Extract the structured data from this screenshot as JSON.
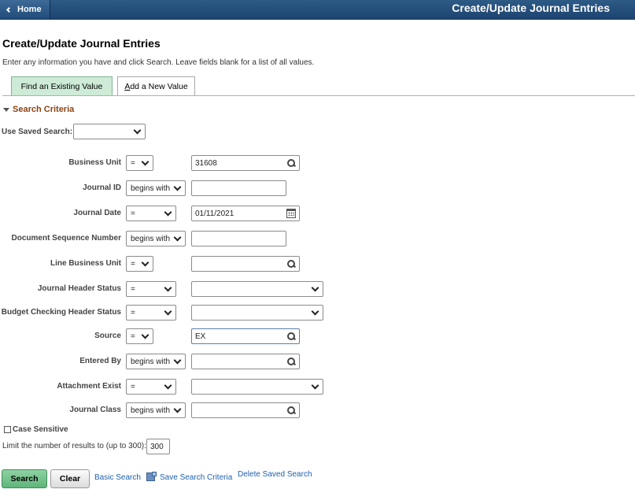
{
  "topbar": {
    "home_label": "Home",
    "title": "Create/Update Journal Entries"
  },
  "page": {
    "title": "Create/Update Journal Entries",
    "instructions": "Enter any information you have and click Search. Leave fields blank for a list of all values."
  },
  "tabs": [
    {
      "label": "Find an Existing Value",
      "active": true
    },
    {
      "label_underlined": "A",
      "label_rest": "dd a New Value",
      "active": false
    }
  ],
  "search_criteria": {
    "heading": "Search Criteria",
    "saved_search_label": "Use Saved Search:",
    "saved_search_value": ""
  },
  "fields": [
    {
      "label": "Business Unit",
      "operator": "=",
      "value": "31608",
      "kind": "lookup"
    },
    {
      "label": "Journal ID",
      "operator": "begins with",
      "value": "",
      "kind": "text"
    },
    {
      "label": "Journal Date",
      "operator": "=",
      "value": "01/11/2021",
      "kind": "date"
    },
    {
      "label": "Document Sequence Number",
      "operator": "begins with",
      "value": "",
      "kind": "text"
    },
    {
      "label": "Line Business Unit",
      "operator": "=",
      "value": "",
      "kind": "lookup"
    },
    {
      "label": "Journal Header Status",
      "operator": "=",
      "value": "",
      "kind": "select"
    },
    {
      "label": "Budget Checking Header Status",
      "operator": "=",
      "value": "",
      "kind": "select"
    },
    {
      "label": "Source",
      "operator": "=",
      "value": "EX",
      "kind": "lookup"
    },
    {
      "label": "Entered By",
      "operator": "begins with",
      "value": "",
      "kind": "lookup"
    },
    {
      "label": "Attachment Exist",
      "operator": "=",
      "value": "",
      "kind": "select"
    },
    {
      "label": "Journal Class",
      "operator": "begins with",
      "value": "",
      "kind": "lookup"
    }
  ],
  "options": {
    "case_sensitive_label": "Case Sensitive",
    "case_sensitive_checked": false,
    "limit_label": "Limit the number of results to (up to 300):",
    "limit_value": "300"
  },
  "actions": {
    "search": "Search",
    "clear": "Clear",
    "basic_search": "Basic Search",
    "save_search": "Save Search Criteria",
    "delete_saved": "Delete Saved Search"
  },
  "colors": {
    "topbar": "#1d4470",
    "primary_button": "#5fb57a",
    "section_heading": "#8b4513",
    "link": "#1f5fae"
  }
}
